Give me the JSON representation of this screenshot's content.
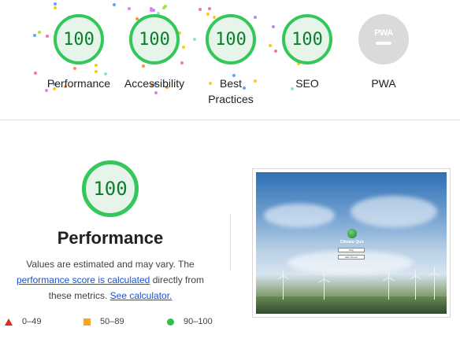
{
  "summary_gauges": [
    {
      "value": "100",
      "label": "Performance"
    },
    {
      "value": "100",
      "label": "Accessibility"
    },
    {
      "value": "100",
      "label": "Best Practices"
    },
    {
      "value": "100",
      "label": "SEO"
    }
  ],
  "pwa": {
    "badge_text": "PWA",
    "label": "PWA"
  },
  "performance": {
    "score": "100",
    "title": "Performance",
    "desc_line1": "Values are estimated and may vary. The",
    "score_link": "performance score is calculated",
    "desc_mid": "directly from",
    "desc_line3": "these metrics.",
    "calculator_link": "See calculator."
  },
  "legend": [
    {
      "range": "0–49",
      "color": "#e0281e"
    },
    {
      "range": "50–89",
      "color": "#f4a623"
    },
    {
      "range": "90–100",
      "color": "#2fbe4e"
    }
  ],
  "screenshot": {
    "app_title": "Climate Quiz",
    "play_button": "Play",
    "help_button": "Help Screen"
  },
  "colors": {
    "pass_green": "#34c759",
    "pass_text": "#0a7f2e",
    "link_blue": "#1a4fd6"
  }
}
